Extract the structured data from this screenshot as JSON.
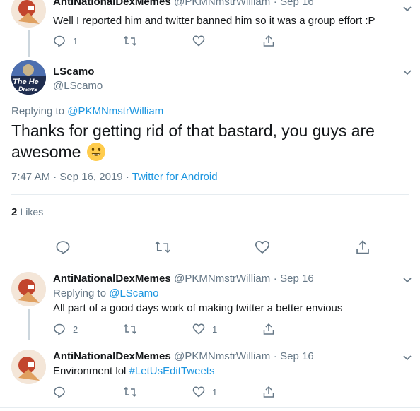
{
  "tweets": [
    {
      "display_name": "AntiNationalDexMemes",
      "handle": "@PKMNmstrWilliam",
      "sep": "·",
      "date": "Sep 16",
      "text": "Well I reported him and twitter banned him so it was a group effort :P",
      "reply_count": "1",
      "retweet_count": "",
      "like_count": ""
    },
    {
      "display_name": "AntiNationalDexMemes",
      "handle": "@PKMNmstrWilliam",
      "sep": "·",
      "date": "Sep 16",
      "replying_label": "Replying to",
      "replying_handle": "@LScamo",
      "text": "All part of a good days work of making twitter a better envious",
      "reply_count": "2",
      "retweet_count": "",
      "like_count": "1"
    },
    {
      "display_name": "AntiNationalDexMemes",
      "handle": "@PKMNmstrWilliam",
      "sep": "·",
      "date": "Sep 16",
      "text_plain": "Environment lol",
      "hashtag": "#LetUsEditTweets",
      "reply_count": "",
      "retweet_count": "",
      "like_count": "1"
    }
  ],
  "main_tweet": {
    "display_name": "LScamo",
    "handle": "@LScamo",
    "avatar_text_1": "The He",
    "avatar_text_2": "Draws",
    "replying_label": "Replying to",
    "replying_handle": "@PKMNmstrWilliam",
    "text_line1": "Thanks for getting rid of that bastard, you guys are",
    "text_line2": "awesome",
    "emoji": "😃",
    "time": "7:47 AM",
    "sep": "·",
    "date": "Sep 16, 2019",
    "source": "Twitter for Android",
    "likes_count": "2",
    "likes_label": "Likes"
  },
  "colors": {
    "accent": "#1b95e0",
    "muted": "#657786",
    "text": "#14171a",
    "divider": "#e6ecf0",
    "emoji": "#ffcc4d"
  }
}
